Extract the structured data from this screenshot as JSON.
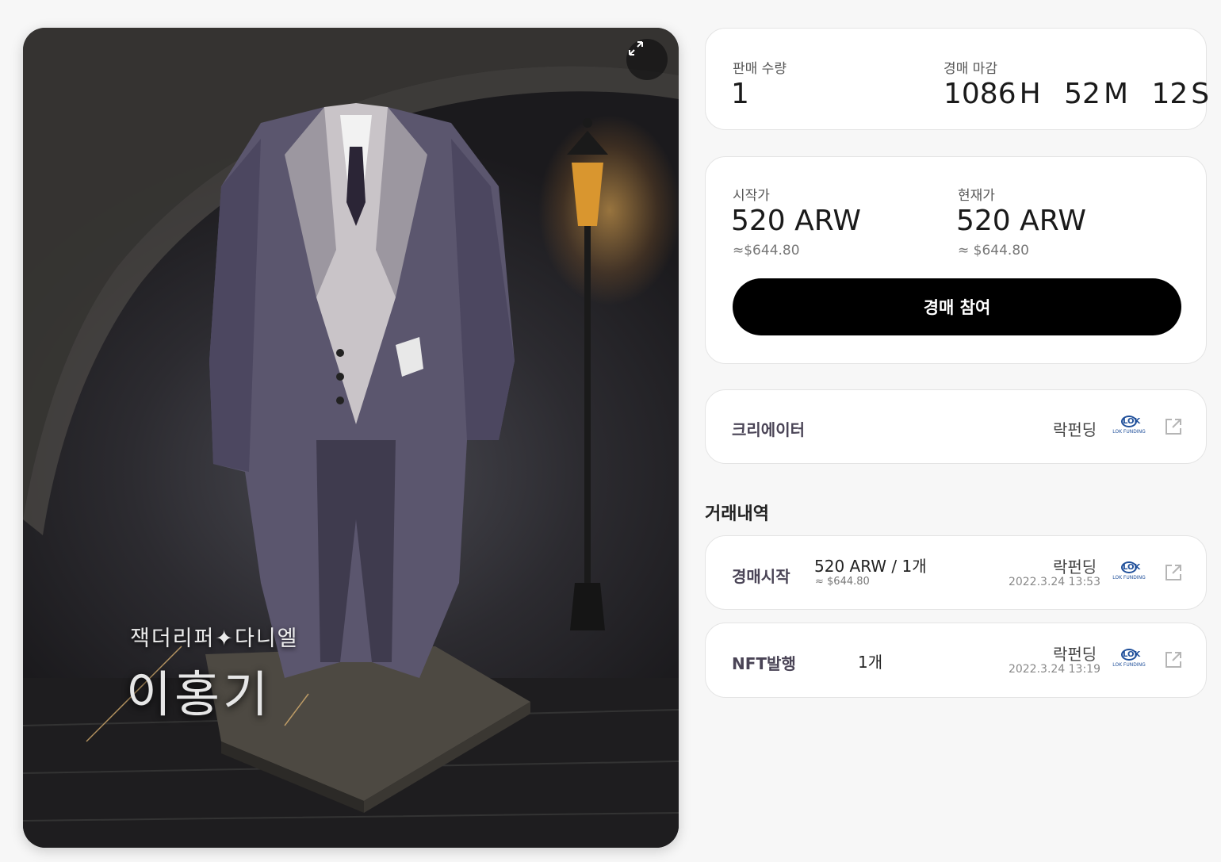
{
  "artwork": {
    "subtitle": "잭더리퍼✦다니엘",
    "title": "이홍기",
    "expand_icon": "expand-icon"
  },
  "sale": {
    "quantity_label": "판매 수량",
    "quantity_value": "1",
    "deadline_label": "경매 마감",
    "deadline_hours": "1086",
    "deadline_hours_unit": "H",
    "deadline_minutes": "52",
    "deadline_minutes_unit": "M",
    "deadline_seconds": "12",
    "deadline_seconds_unit": "S"
  },
  "price": {
    "start_label": "시작가",
    "start_value": "520 ARW",
    "start_usd": "≈$644.80",
    "current_label": "현재가",
    "current_value": "520 ARW",
    "current_usd": "≈ $644.80",
    "bid_button": "경매 참여"
  },
  "creator": {
    "label": "크리에이터",
    "name": "락펀딩",
    "logo_text": "LOK FUNDING",
    "logo_mark": "LOK"
  },
  "history": {
    "title": "거래내역",
    "items": [
      {
        "type": "경매시작",
        "amount": "520 ARW / 1개",
        "usd": "≈ $644.80",
        "user": "락펀딩",
        "date": "2022.3.24 13:53"
      },
      {
        "type": "NFT발행",
        "amount": "1개",
        "usd": "",
        "user": "락펀딩",
        "date": "2022.3.24 13:19"
      }
    ]
  },
  "colors": {
    "button_bg": "#000000",
    "card_border": "#e4e4e4",
    "logo_blue": "#1f4f9a",
    "row_label": "#4a4456"
  }
}
